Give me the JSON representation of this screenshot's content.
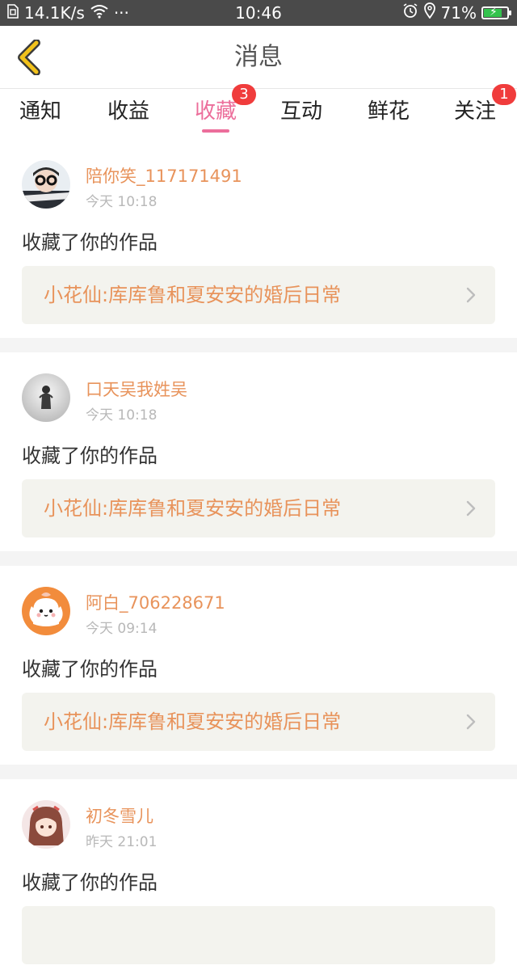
{
  "status_bar": {
    "network_speed": "14.1K/s",
    "more": "···",
    "time": "10:46",
    "battery": "71%"
  },
  "header": {
    "title": "消息"
  },
  "tabs": [
    {
      "label": "通知",
      "active": false,
      "badge": ""
    },
    {
      "label": "收益",
      "active": false,
      "badge": ""
    },
    {
      "label": "收藏",
      "active": true,
      "badge": "3"
    },
    {
      "label": "互动",
      "active": false,
      "badge": ""
    },
    {
      "label": "鲜花",
      "active": false,
      "badge": ""
    },
    {
      "label": "关注",
      "active": false,
      "badge": "1"
    }
  ],
  "messages": [
    {
      "user": "陪你笑_117171491",
      "time": "今天 10:18",
      "action": "收藏了你的作品",
      "work": "小花仙:库库鲁和夏安安的婚后日常"
    },
    {
      "user": "口天吴我姓吴",
      "time": "今天 10:18",
      "action": "收藏了你的作品",
      "work": "小花仙:库库鲁和夏安安的婚后日常"
    },
    {
      "user": "阿白_706228671",
      "time": "今天 09:14",
      "action": "收藏了你的作品",
      "work": "小花仙:库库鲁和夏安安的婚后日常"
    },
    {
      "user": "初冬雪儿",
      "time": "昨天 21:01",
      "action": "收藏了你的作品",
      "work": ""
    }
  ],
  "colors": {
    "accent": "#ec6e9b",
    "username": "#e8935b",
    "badge": "#f03c3c",
    "back_icon": "#f2c21b"
  }
}
